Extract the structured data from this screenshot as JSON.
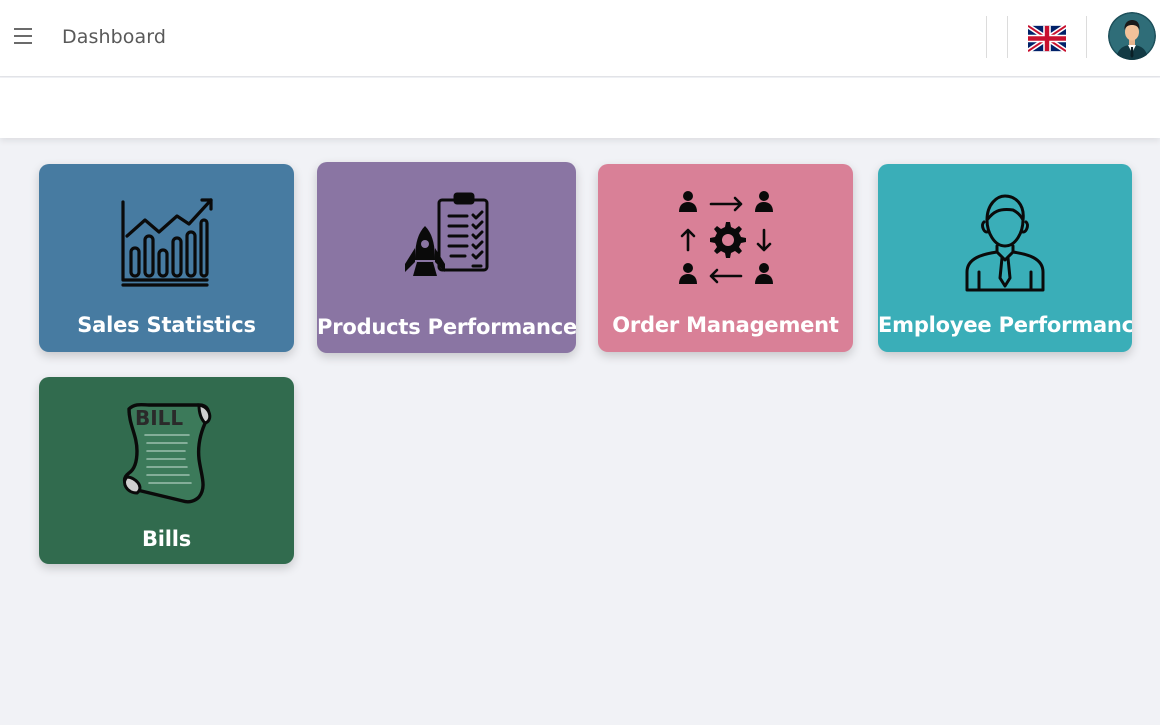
{
  "header": {
    "title": "Dashboard",
    "menu_icon": "hamburger-menu-icon",
    "language_flag": "uk-flag-icon",
    "avatar_icon": "user-avatar-icon"
  },
  "cards": [
    {
      "label": "Sales Statistics",
      "color": "#477ba1",
      "icon": "bar-chart-trend-icon"
    },
    {
      "label": "Products Performance",
      "color": "#8a75a3",
      "icon": "rocket-checklist-icon"
    },
    {
      "label": "Order Management",
      "color": "#d98097",
      "icon": "gear-people-arrows-icon"
    },
    {
      "label": "Employee Performance",
      "color": "#3aaeb8",
      "icon": "employee-icon"
    },
    {
      "label": "Bills",
      "color": "#316b4e",
      "icon": "bill-scroll-icon",
      "icon_text": "BILL"
    }
  ]
}
